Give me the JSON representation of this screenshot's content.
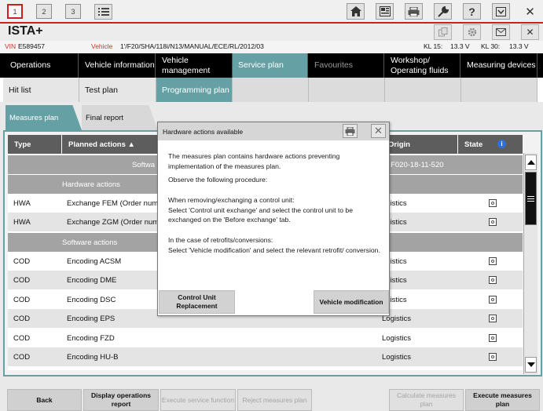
{
  "topbar": {
    "tabs": [
      "1",
      "2",
      "3"
    ]
  },
  "app": {
    "title": "ISTA+"
  },
  "info": {
    "vin_label": "VIN",
    "vin": "E589457",
    "vehicle_label": "Vehicle",
    "vehicle": "1'/F20/SHA/118i/N13/MANUAL/ECE/RL/2012/03",
    "kl15_label": "KL 15:",
    "kl15": "13.3 V",
    "kl30_label": "KL 30:",
    "kl30": "13.3 V"
  },
  "mainnav": {
    "items": [
      "Operations",
      "Vehicle information",
      "Vehicle management",
      "Service plan",
      "Favourites",
      "Workshop/ Operating fluids",
      "Measuring devices"
    ]
  },
  "subnav": {
    "items": [
      "Hit list",
      "Test plan",
      "Programming plan"
    ]
  },
  "content_tabs": [
    "Measures plan",
    "Final report"
  ],
  "table": {
    "headers": [
      "Type",
      "Planned actions ▲",
      "Origin",
      "State"
    ],
    "info_row_left": "Softwa",
    "info_row_right": "t): F020-18-11-520",
    "groups": {
      "hardware": "Hardware actions",
      "software": "Software actions"
    },
    "hw_rows": [
      {
        "type": "HWA",
        "action": "Exchange FEM (Order num",
        "origin": "ogistics"
      },
      {
        "type": "HWA",
        "action": "Exchange ZGM (Order num",
        "origin": "ogistics"
      }
    ],
    "sw_rows": [
      {
        "type": "COD",
        "action": "Encoding ACSM",
        "origin": "ogistics"
      },
      {
        "type": "COD",
        "action": "Encoding DME",
        "origin": "ogistics"
      },
      {
        "type": "COD",
        "action": "Encoding DSC",
        "origin": "ogistics"
      },
      {
        "type": "COD",
        "action": "Encoding EPS",
        "origin": "Logistics"
      },
      {
        "type": "COD",
        "action": "Encoding FZD",
        "origin": "Logistics"
      },
      {
        "type": "COD",
        "action": "Encoding HU-B",
        "origin": "Logistics"
      }
    ]
  },
  "dialog": {
    "title": "Hardware actions available",
    "p1": "The measures plan contains hardware actions preventing implementation of the measures plan.",
    "p2": "Observe the following procedure:",
    "p3_line1": "When removing/exchanging a control unit:",
    "p3_line2": "Select 'Control unit exchange' and select the control unit to be exchanged on the 'Before exchange' tab.",
    "p4_line1": "In the case of retrofits/conversions:",
    "p4_line2": "Select 'Vehicle modification' and select the relevant retrofit/ conversion.",
    "btn_cu": "Control Unit Replacement",
    "btn_vm": "Vehicle modification"
  },
  "footer": {
    "back": "Back",
    "display_report": "Display operations report",
    "execute_service": "Execute service function",
    "reject": "Reject measures plan",
    "calculate": "Calculate measures plan",
    "execute_plan": "Execute measures plan"
  },
  "colors": {
    "accent": "#65a1a4",
    "brand_red": "#d01e1e",
    "header_dark": "#5d5d5d",
    "group_gray": "#a3a3a3"
  },
  "icons": [
    "home-icon",
    "vehicle-data-icon",
    "print-icon",
    "wrench-icon",
    "help-icon",
    "minimize-icon",
    "close-icon",
    "list-icon",
    "copy-icon",
    "settings-icon",
    "mail-icon",
    "info-icon"
  ]
}
